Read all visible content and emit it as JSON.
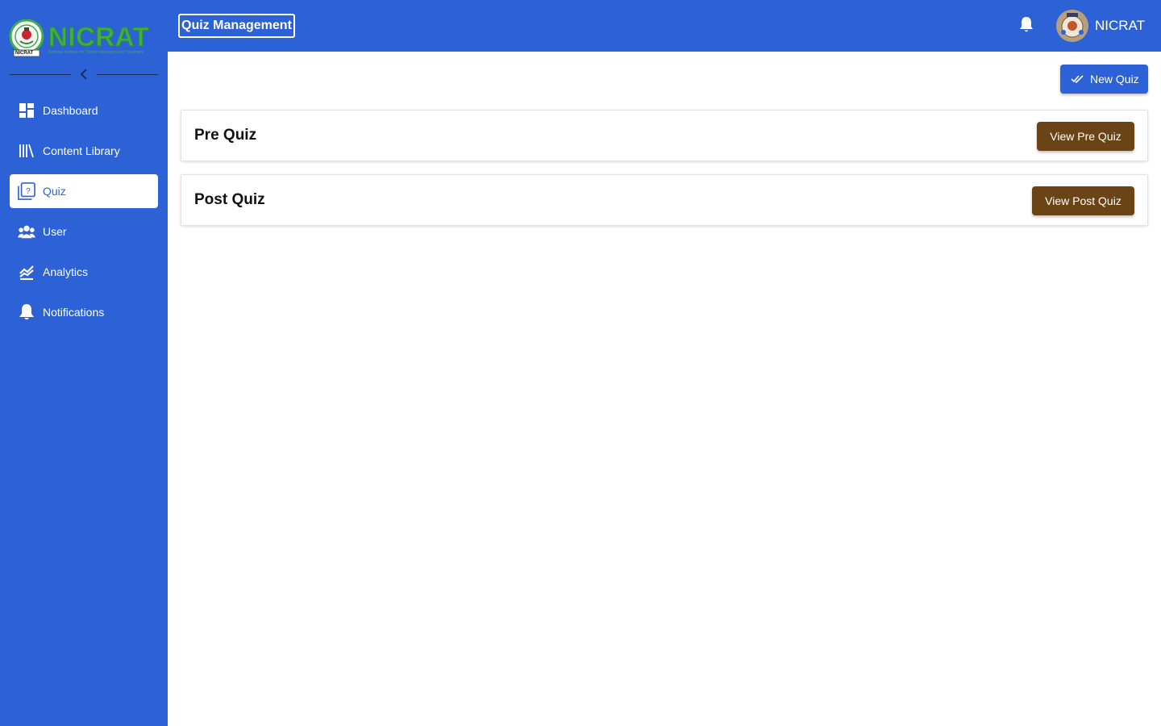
{
  "brand": {
    "name": "NICRAT",
    "tagline": "National Institute for Cancer Research and Treatment",
    "seal_text": "NICRAT",
    "color_primary": "#2d62d6",
    "color_logo": "#3fae49"
  },
  "sidebar": {
    "collapse_icon": "chevron-left-icon",
    "items": [
      {
        "label": "Dashboard",
        "icon": "dashboard-icon",
        "active": false
      },
      {
        "label": "Content Library",
        "icon": "library-icon",
        "active": false
      },
      {
        "label": "Quiz",
        "icon": "quiz-icon",
        "active": true
      },
      {
        "label": "User",
        "icon": "users-icon",
        "active": false
      },
      {
        "label": "Analytics",
        "icon": "analytics-icon",
        "active": false
      },
      {
        "label": "Notifications",
        "icon": "bell-icon",
        "active": false
      }
    ]
  },
  "header": {
    "title": "Quiz Management",
    "notification_icon": "bell-icon",
    "user_name": "NICRAT"
  },
  "main": {
    "new_quiz_label": "New Quiz",
    "new_quiz_icon": "double-check-icon",
    "quizzes": [
      {
        "title": "Pre Quiz",
        "button_label": "View Pre Quiz",
        "button_color": "#6b4416"
      },
      {
        "title": "Post Quiz",
        "button_label": "View Post Quiz",
        "button_color": "#6b4416"
      }
    ]
  }
}
